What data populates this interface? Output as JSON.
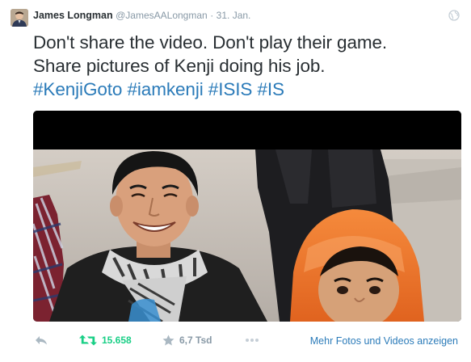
{
  "tweet": {
    "author_name": "James Longman",
    "handle": "@JamesAALongman",
    "separator": "·",
    "date": "31. Jan.",
    "text_line1": "Don't share the video. Don't play their game.",
    "text_line2": "Share pictures of Kenji doing his job.",
    "hashtags": [
      "#KenjiGoto",
      "#iamkenji",
      "#ISIS",
      "#IS"
    ]
  },
  "actions": {
    "retweet_count": "15.658",
    "favorite_count": "6,7 Tsd",
    "more_media_label": "Mehr Fotos und Videos anzeigen"
  },
  "icons": {
    "reply": "reply-icon",
    "retweet": "retweet-icon",
    "favorite": "star-icon",
    "more": "more-dots-icon",
    "globe": "globe-icon"
  },
  "colors": {
    "link": "#2b7bb9",
    "retweet_active": "#19cf86",
    "muted": "#8899a6",
    "text": "#292f33"
  }
}
